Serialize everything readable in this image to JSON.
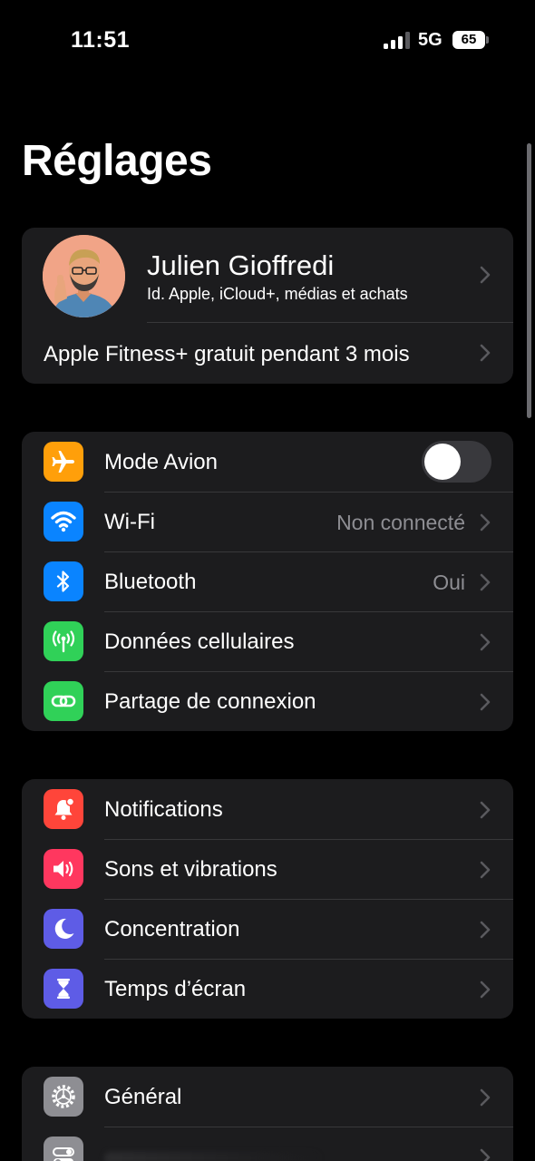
{
  "status_bar": {
    "time": "11:51",
    "network": "5G",
    "battery": "65",
    "signal_bars_active": 3,
    "signal_bars_total": 4
  },
  "page_title": "Réglages",
  "profile": {
    "name": "Julien Gioffredi",
    "subtitle": "Id. Apple, iCloud+, médias et achats",
    "avatar_icon": "memoji-avatar",
    "promo": "Apple Fitness+ gratuit pendant 3 mois"
  },
  "connectivity": [
    {
      "label": "Mode Avion",
      "icon": "airplane-icon",
      "color": "#ff9f0a",
      "toggle": false
    },
    {
      "label": "Wi-Fi",
      "icon": "wifi-icon",
      "color": "#0a84ff",
      "value": "Non connecté"
    },
    {
      "label": "Bluetooth",
      "icon": "bluetooth-icon",
      "color": "#0a84ff",
      "value": "Oui"
    },
    {
      "label": "Données cellulaires",
      "icon": "cellular-antenna-icon",
      "color": "#30d158"
    },
    {
      "label": "Partage de connexion",
      "icon": "chain-link-icon",
      "color": "#30d158"
    }
  ],
  "attention": [
    {
      "label": "Notifications",
      "icon": "bell-icon",
      "color": "#ff453a"
    },
    {
      "label": "Sons et vibrations",
      "icon": "speaker-icon",
      "color": "#ff375f"
    },
    {
      "label": "Concentration",
      "icon": "moon-icon",
      "color": "#5e5ce6"
    },
    {
      "label": "Temps d’écran",
      "icon": "hourglass-icon",
      "color": "#5e5ce6"
    }
  ],
  "system": [
    {
      "label": "Général",
      "icon": "gear-icon",
      "color": "#8e8e93"
    },
    {
      "label": "",
      "icon": "switches-icon",
      "color": "#8e8e93"
    }
  ]
}
